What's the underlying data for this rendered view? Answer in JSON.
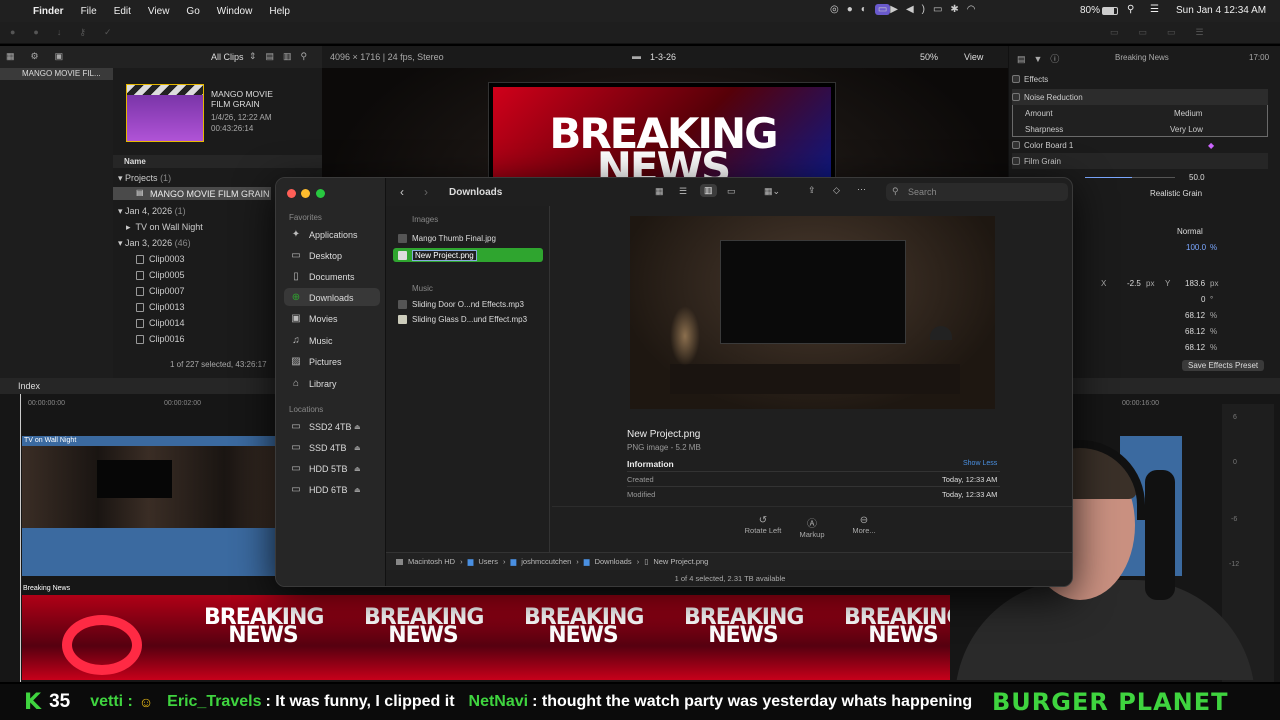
{
  "menubar": {
    "app": "Finder",
    "items": [
      "File",
      "Edit",
      "View",
      "Go",
      "Window",
      "Help"
    ],
    "battery": "80%",
    "clock": "Sun Jan 4  12:34 AM"
  },
  "fcp": {
    "library_name": "MANGO MOVIE FIL...",
    "clips_filter": "All Clips",
    "event_title": "MANGO MOVIE FILM GRAIN",
    "event_date": "1/4/26, 12:22 AM",
    "event_duration": "00:43:26:14",
    "name_col": "Name",
    "projects": "Projects",
    "projects_count": "(1)",
    "project_item": "MANGO MOVIE FILM GRAIN",
    "date1": "Jan 4, 2026",
    "date1_count": "(1)",
    "tv_item": "TV on Wall Night",
    "date2": "Jan 3, 2026",
    "date2_count": "(46)",
    "clips": [
      "Clip0003",
      "Clip0005",
      "Clip0007",
      "Clip0013",
      "Clip0014",
      "Clip0016"
    ],
    "selection_status": "1 of 227 selected, 43:26:17",
    "viewer_format": "4096 × 1716 | 24 fps, Stereo",
    "viewer_title": "1-3-26",
    "zoom": "50%",
    "view": "View",
    "inspector_title": "Breaking News",
    "inspector_time": "17:00",
    "effects": "Effects",
    "noise_reduction": "Noise Reduction",
    "amount_label": "Amount",
    "amount_value": "Medium",
    "sharpness_label": "Sharpness",
    "sharpness_value": "Very Low",
    "color_board": "Color Board 1",
    "film_grain": "Film Grain",
    "grain_value": "50.0",
    "grain_preset": "Realistic Grain",
    "blend": "Normal",
    "opacity": "100.0",
    "pos_x_label": "X",
    "pos_x": "-2.5",
    "pos_y_label": "Y",
    "pos_y": "183.6",
    "px": "px",
    "rotation": "0",
    "deg": "°",
    "pct": "%",
    "scale": [
      "68.12",
      "68.12",
      "68.12"
    ],
    "save_preset": "Save Effects Preset",
    "index": "Index",
    "tc1": "00:00:00:00",
    "tc2": "00:00:02:00",
    "tc3": "00:00:16:00",
    "clip_label": "TV on Wall Night",
    "bn_label": "Breaking News",
    "breaking_text": "BREAKING NEWS",
    "meter_marks": [
      "6",
      "0",
      "-6",
      "-12"
    ]
  },
  "finder": {
    "title": "Downloads",
    "search_placeholder": "Search",
    "favorites_label": "Favorites",
    "favorites": [
      {
        "label": "Applications",
        "icon": "applications-icon"
      },
      {
        "label": "Desktop",
        "icon": "desktop-icon"
      },
      {
        "label": "Documents",
        "icon": "documents-icon"
      },
      {
        "label": "Downloads",
        "icon": "downloads-icon"
      },
      {
        "label": "Movies",
        "icon": "movies-icon"
      },
      {
        "label": "Music",
        "icon": "music-icon"
      },
      {
        "label": "Pictures",
        "icon": "pictures-icon"
      },
      {
        "label": "Library",
        "icon": "library-icon"
      }
    ],
    "locations_label": "Locations",
    "locations": [
      "SSD2 4TB",
      "SSD 4TB",
      "HDD 5TB",
      "HDD 6TB"
    ],
    "images_label": "Images",
    "images": [
      "Mango Thumb Final.jpg",
      "New Project.png"
    ],
    "music_label": "Music",
    "music": [
      "Sliding Door O...nd Effects.mp3",
      "Sliding Glass D...und Effect.mp3"
    ],
    "preview_name": "New Project.png",
    "preview_kind": "PNG image - 5.2 MB",
    "information": "Information",
    "show_less": "Show Less",
    "created_label": "Created",
    "created_value": "Today, 12:33 AM",
    "modified_label": "Modified",
    "modified_value": "Today, 12:33 AM",
    "actions": [
      "Rotate Left",
      "Markup",
      "More..."
    ],
    "path": [
      "Macintosh HD",
      "Users",
      "joshmccutchen",
      "Downloads",
      "New Project.png"
    ],
    "status": "1 of 4 selected, 2.31 TB available",
    "accent": "#2fa52f"
  },
  "ticker": {
    "k": "K",
    "count": "35",
    "prev": "vetti :",
    "user1": "Eric_Travels",
    "msg1": ": It was funny, I clipped it",
    "user2": "NetNavi",
    "msg2": ": thought the watch party was yesterday whats happening",
    "brand": "BURGER PLANET"
  }
}
